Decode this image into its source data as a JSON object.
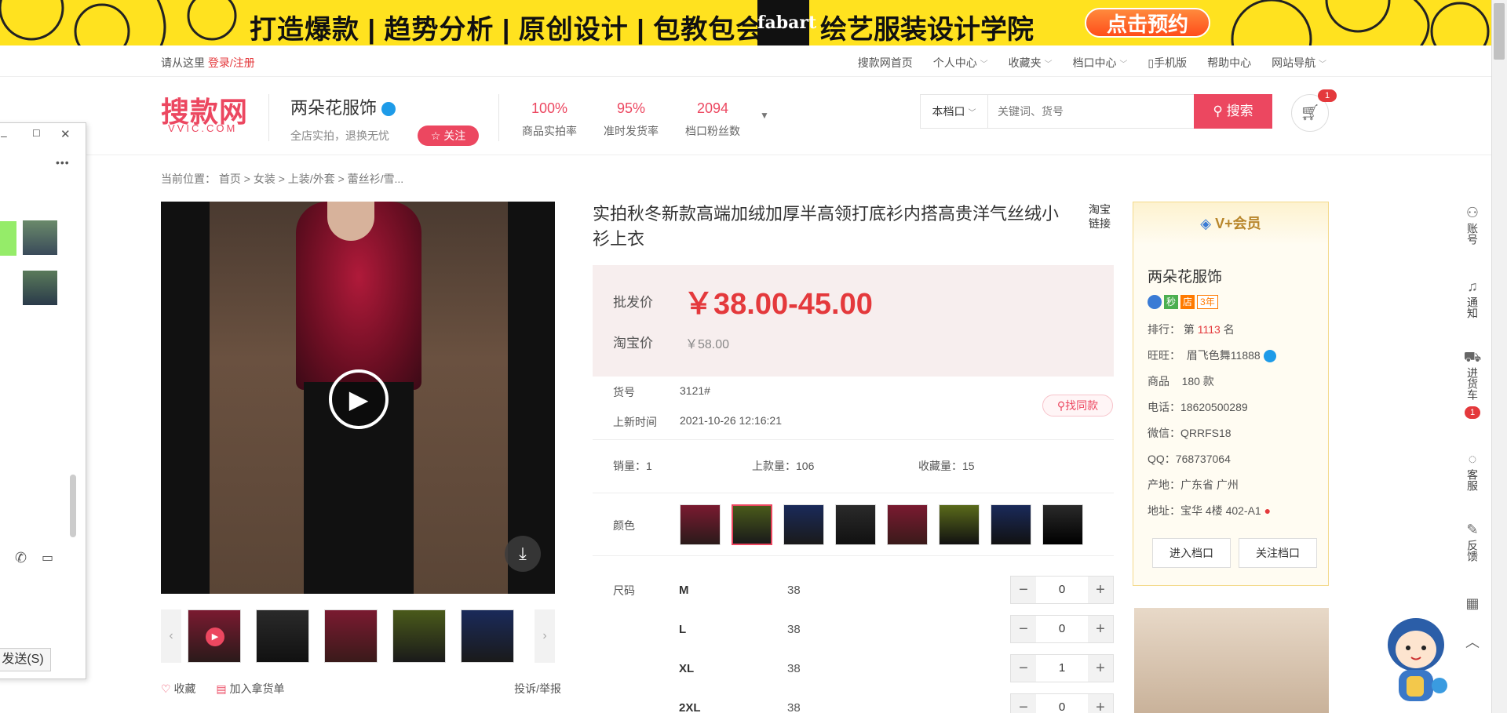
{
  "banner": {
    "slogan": "打造爆款 | 趋势分析 | 原创设计 | 包教包会",
    "logo": "fabart",
    "school": "绘艺服装设计学院",
    "cta": "点击预约"
  },
  "topnav": {
    "login_prefix": "请从这里",
    "login_link": "登录/注册",
    "links": [
      "搜款网首页",
      "个人中心",
      "收藏夹",
      "档口中心",
      "手机版",
      "帮助中心",
      "网站导航"
    ]
  },
  "header": {
    "site_logo": "搜款网",
    "site_logo_sub": "VVIC.COM",
    "shop_name": "两朵花服饰",
    "shop_slogan": "全店实拍，退换无忧",
    "follow_label": "关注",
    "stats": [
      {
        "value": "100%",
        "label": "商品实拍率"
      },
      {
        "value": "95%",
        "label": "准时发货率"
      },
      {
        "value": "2094",
        "label": "档口粉丝数"
      }
    ],
    "search_scope": "本档口",
    "search_placeholder": "关键词、货号",
    "search_button": "搜索",
    "cart_count": "1"
  },
  "chat": {
    "send_label": "发送(S)"
  },
  "breadcrumb": "当前位置：  首页 > 女装 > 上装/外套 > 蕾丝衫/雪...",
  "gallery": {
    "actions": {
      "fav": "收藏",
      "list": "加入拿货单",
      "report": "投诉/举报"
    }
  },
  "product": {
    "title": "实拍秋冬新款高端加绒加厚半高领打底衫内搭高贵洋气丝绒小衫上衣",
    "taobao_link": "淘宝链接",
    "wholesale_label": "批发价",
    "wholesale_price": "￥38.00-45.00",
    "taobao_label": "淘宝价",
    "taobao_price": "￥58.00",
    "sku_label": "货号",
    "sku": "3121#",
    "date_label": "上新时间",
    "date": "2021-10-26 12:16:21",
    "find_same": "找同款",
    "sales": "销量：1",
    "listings": "上款量：106",
    "favorites": "收藏量：15",
    "color_label": "颜色",
    "size_label": "尺码",
    "sizes": [
      {
        "size": "M",
        "price": "38",
        "qty": "0"
      },
      {
        "size": "L",
        "price": "38",
        "qty": "0"
      },
      {
        "size": "XL",
        "price": "38",
        "qty": "1"
      },
      {
        "size": "2XL",
        "price": "38",
        "qty": "0"
      }
    ]
  },
  "shop": {
    "vip": "V+会员",
    "name": "两朵花服饰",
    "badge_second": "秒",
    "badge_shop": "店",
    "badge_years": "3年",
    "rank_label": "排行：",
    "rank_prefix": "第",
    "rank": "1113",
    "rank_suffix": "名",
    "wangwang_label": "旺旺：",
    "wangwang": "眉飞色舞11888",
    "goods_label": "商品",
    "goods": "180 款",
    "phone_label": "电话：",
    "phone": "18620500289",
    "wechat_label": "微信：",
    "wechat": "QRRFS18",
    "qq_label": "QQ：",
    "qq": "768737064",
    "origin_label": "产地：",
    "origin": "广东省 广州",
    "address_label": "地址：",
    "address": "宝华 4楼 402-A1",
    "enter_btn": "进入档口",
    "follow_btn": "关注档口"
  },
  "rail": {
    "account": "账号",
    "notify": "通知",
    "cart": "进货车",
    "cart_count": "1",
    "service": "客服",
    "feedback": "反馈"
  }
}
